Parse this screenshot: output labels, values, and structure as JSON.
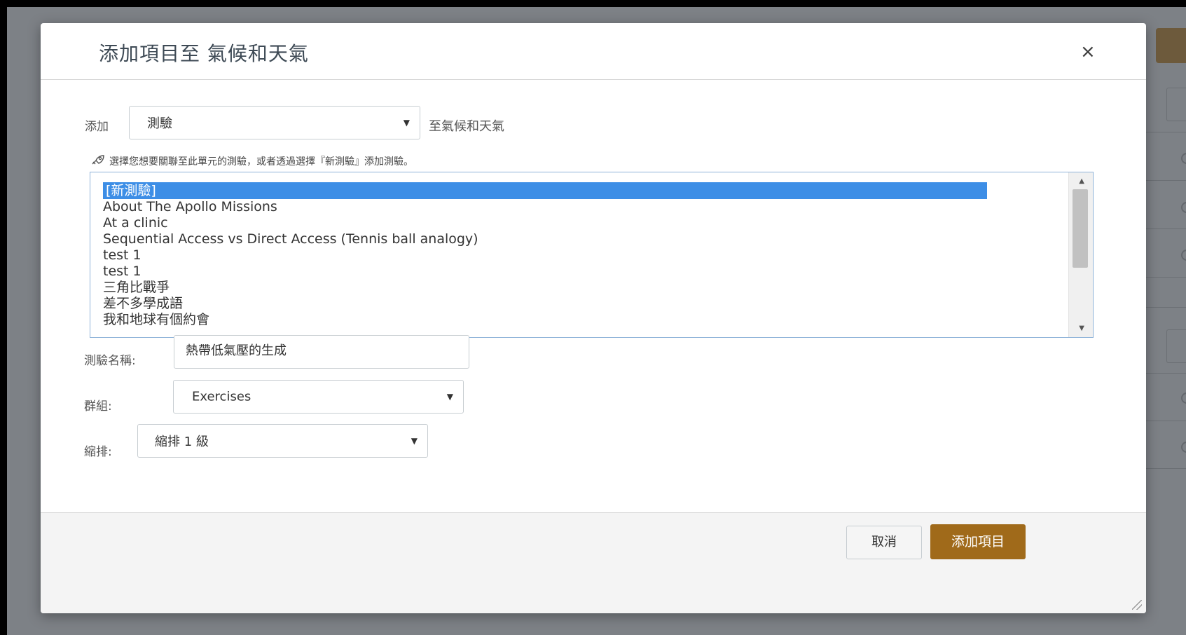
{
  "dialog": {
    "title": "添加項目至 氣候和天氣",
    "close_label": "×",
    "add_label": "添加",
    "type_select": {
      "selected": "測驗"
    },
    "to_text": "至氣候和天氣",
    "hint": "選擇您想要關聯至此單元的測驗，或者透過選擇『新測驗』添加測驗。",
    "quiz_list": [
      "[新測驗]",
      "About The Apollo Missions",
      "At a clinic",
      "Sequential Access vs Direct Access (Tennis ball analogy)",
      "test 1",
      "test 1",
      "三角比戰爭",
      "差不多學成語",
      "我和地球有個約會"
    ],
    "quiz_name_label": "測驗名稱:",
    "quiz_name_value": "熱帶低氣壓的生成",
    "group_label": "群組:",
    "group_select": {
      "selected": "Exercises"
    },
    "indent_label": "縮排:",
    "indent_select": {
      "selected": "縮排 1 級"
    },
    "cancel_label": "取消",
    "submit_label": "添加項目"
  },
  "colors": {
    "selection": "#3d8ee6",
    "primary_button": "#a06a1a",
    "overlay": "#7d8186"
  },
  "icons": {
    "hint_icon": "rocket-icon",
    "caret": "caret-down-icon"
  }
}
